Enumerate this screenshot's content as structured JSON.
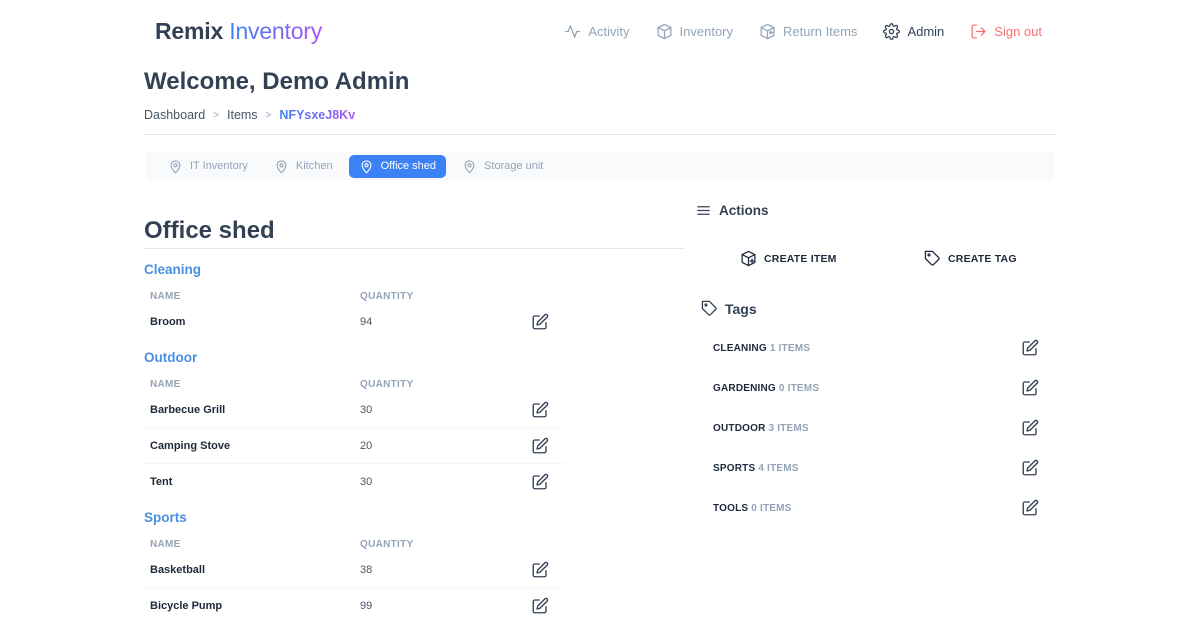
{
  "brand": {
    "part1": "Remix",
    "part2": "Inventory"
  },
  "nav": [
    {
      "label": "Activity",
      "icon": "activity-icon"
    },
    {
      "label": "Inventory",
      "icon": "box-icon"
    },
    {
      "label": "Return Items",
      "icon": "box-return-icon"
    },
    {
      "label": "Admin",
      "icon": "gear-icon"
    },
    {
      "label": "Sign out",
      "icon": "sign-out-icon"
    }
  ],
  "welcome": "Welcome, Demo Admin",
  "breadcrumb": {
    "items": [
      "Dashboard",
      "Items",
      "NFYsxeJ8Kv"
    ],
    "separator": ">"
  },
  "locations": [
    {
      "label": "IT Inventory",
      "active": false
    },
    {
      "label": "Kitchen",
      "active": false
    },
    {
      "label": "Office shed",
      "active": true
    },
    {
      "label": "Storage unit",
      "active": false
    }
  ],
  "office": {
    "title": "Office shed",
    "columns": {
      "name": "NAME",
      "quantity": "QUANTITY"
    },
    "categories": [
      {
        "title": "Cleaning",
        "items": [
          {
            "name": "Broom",
            "quantity": "94"
          }
        ]
      },
      {
        "title": "Outdoor",
        "items": [
          {
            "name": "Barbecue Grill",
            "quantity": "30"
          },
          {
            "name": "Camping Stove",
            "quantity": "20"
          },
          {
            "name": "Tent",
            "quantity": "30"
          }
        ]
      },
      {
        "title": "Sports",
        "items": [
          {
            "name": "Basketball",
            "quantity": "38"
          },
          {
            "name": "Bicycle Pump",
            "quantity": "99"
          }
        ]
      }
    ]
  },
  "actions": {
    "title": "Actions",
    "create_item": "CREATE ITEM",
    "create_tag": "CREATE TAG"
  },
  "tags": {
    "title": "Tags",
    "list": [
      {
        "name": "CLEANING",
        "count": "1 ITEMS"
      },
      {
        "name": "GARDENING",
        "count": "0 ITEMS"
      },
      {
        "name": "OUTDOOR",
        "count": "3 ITEMS"
      },
      {
        "name": "SPORTS",
        "count": "4 ITEMS"
      },
      {
        "name": "TOOLS",
        "count": "0 ITEMS"
      }
    ]
  },
  "colors": {
    "accent": "#3b82f6",
    "category": "#4a90e2",
    "signout": "#f87171",
    "muted": "#94a3b8",
    "text": "#334155"
  }
}
